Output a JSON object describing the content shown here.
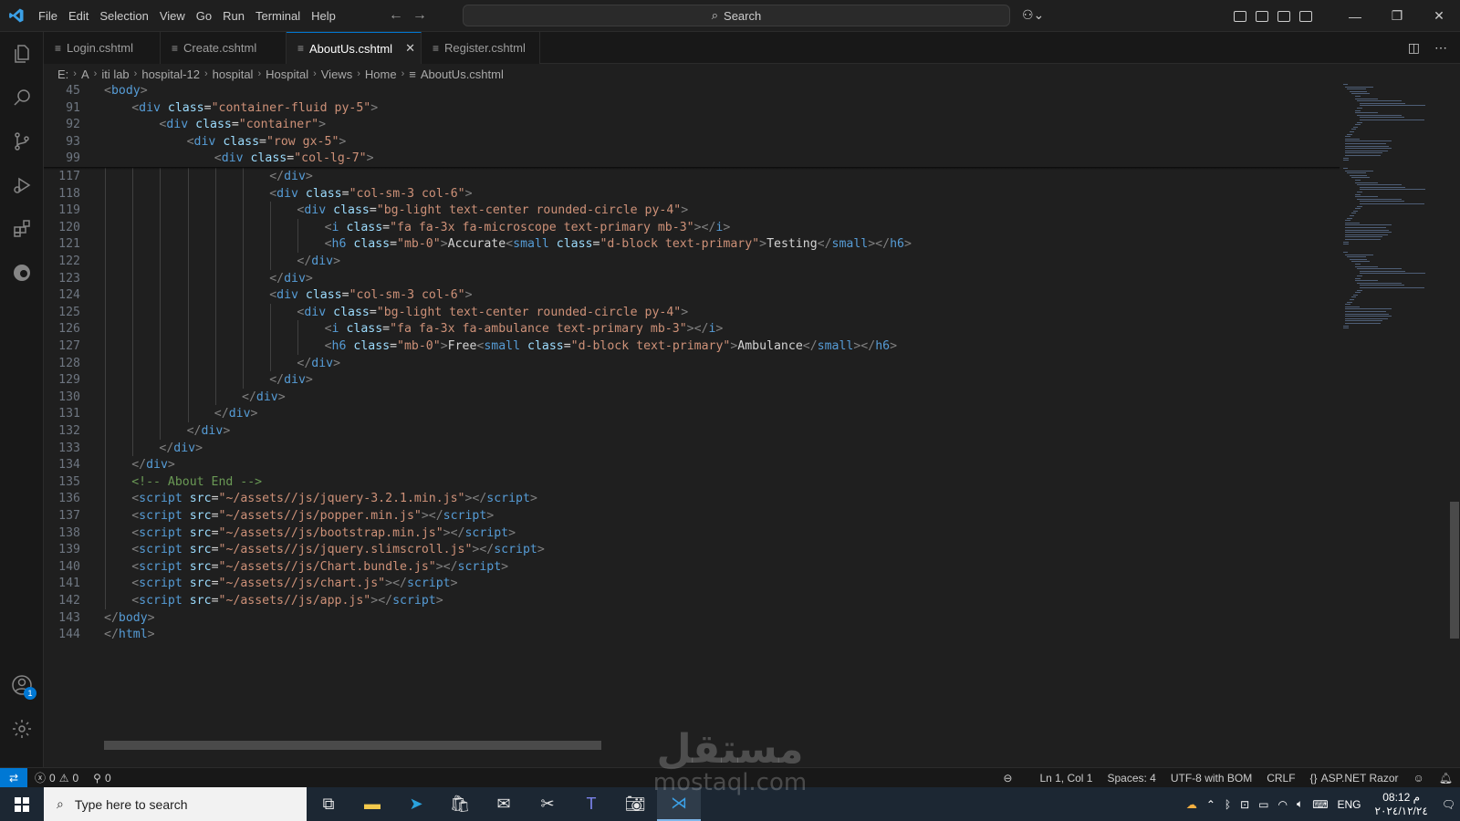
{
  "menu": [
    "File",
    "Edit",
    "Selection",
    "View",
    "Go",
    "Run",
    "Terminal",
    "Help"
  ],
  "search_label": "Search",
  "tabs": [
    {
      "label": "Login.cshtml",
      "active": false
    },
    {
      "label": "Create.cshtml",
      "active": false
    },
    {
      "label": "AboutUs.cshtml",
      "active": true
    },
    {
      "label": "Register.cshtml",
      "active": false
    }
  ],
  "breadcrumb": [
    "E:",
    "A",
    "iti lab",
    "hospital-12",
    "hospital",
    "Hospital",
    "Views",
    "Home",
    "AboutUs.cshtml"
  ],
  "sticky_lines": [
    {
      "num": "45",
      "indent": 0,
      "segs": [
        [
          "br",
          "<"
        ],
        [
          "t",
          "body"
        ],
        [
          "br",
          ">"
        ]
      ]
    },
    {
      "num": "91",
      "indent": 1,
      "segs": [
        [
          "br",
          "<"
        ],
        [
          "t",
          "div"
        ],
        [
          "tx",
          " "
        ],
        [
          "a",
          "class"
        ],
        [
          "tx",
          "="
        ],
        [
          "s",
          "\"container-fluid py-5\""
        ],
        [
          "br",
          ">"
        ]
      ]
    },
    {
      "num": "92",
      "indent": 2,
      "segs": [
        [
          "br",
          "<"
        ],
        [
          "t",
          "div"
        ],
        [
          "tx",
          " "
        ],
        [
          "a",
          "class"
        ],
        [
          "tx",
          "="
        ],
        [
          "s",
          "\"container\""
        ],
        [
          "br",
          ">"
        ]
      ]
    },
    {
      "num": "93",
      "indent": 3,
      "segs": [
        [
          "br",
          "<"
        ],
        [
          "t",
          "div"
        ],
        [
          "tx",
          " "
        ],
        [
          "a",
          "class"
        ],
        [
          "tx",
          "="
        ],
        [
          "s",
          "\"row gx-5\""
        ],
        [
          "br",
          ">"
        ]
      ]
    },
    {
      "num": "99",
      "indent": 4,
      "segs": [
        [
          "br",
          "<"
        ],
        [
          "t",
          "div"
        ],
        [
          "tx",
          " "
        ],
        [
          "a",
          "class"
        ],
        [
          "tx",
          "="
        ],
        [
          "s",
          "\"col-lg-7\""
        ],
        [
          "br",
          ">"
        ]
      ]
    }
  ],
  "lines": [
    {
      "num": "117",
      "indent": 6,
      "segs": [
        [
          "br",
          "</"
        ],
        [
          "t",
          "div"
        ],
        [
          "br",
          ">"
        ]
      ]
    },
    {
      "num": "118",
      "indent": 6,
      "segs": [
        [
          "br",
          "<"
        ],
        [
          "t",
          "div"
        ],
        [
          "tx",
          " "
        ],
        [
          "a",
          "class"
        ],
        [
          "tx",
          "="
        ],
        [
          "s",
          "\"col-sm-3 col-6\""
        ],
        [
          "br",
          ">"
        ]
      ]
    },
    {
      "num": "119",
      "indent": 7,
      "segs": [
        [
          "br",
          "<"
        ],
        [
          "t",
          "div"
        ],
        [
          "tx",
          " "
        ],
        [
          "a",
          "class"
        ],
        [
          "tx",
          "="
        ],
        [
          "s",
          "\"bg-light text-center rounded-circle py-4\""
        ],
        [
          "br",
          ">"
        ]
      ]
    },
    {
      "num": "120",
      "indent": 8,
      "segs": [
        [
          "br",
          "<"
        ],
        [
          "t",
          "i"
        ],
        [
          "tx",
          " "
        ],
        [
          "a",
          "class"
        ],
        [
          "tx",
          "="
        ],
        [
          "s",
          "\"fa fa-3x fa-microscope text-primary mb-3\""
        ],
        [
          "br",
          "></"
        ],
        [
          "t",
          "i"
        ],
        [
          "br",
          ">"
        ]
      ]
    },
    {
      "num": "121",
      "indent": 8,
      "segs": [
        [
          "br",
          "<"
        ],
        [
          "t",
          "h6"
        ],
        [
          "tx",
          " "
        ],
        [
          "a",
          "class"
        ],
        [
          "tx",
          "="
        ],
        [
          "s",
          "\"mb-0\""
        ],
        [
          "br",
          ">"
        ],
        [
          "tx",
          "Accurate"
        ],
        [
          "br",
          "<"
        ],
        [
          "t",
          "small"
        ],
        [
          "tx",
          " "
        ],
        [
          "a",
          "class"
        ],
        [
          "tx",
          "="
        ],
        [
          "s",
          "\"d-block text-primary\""
        ],
        [
          "br",
          ">"
        ],
        [
          "tx",
          "Testing"
        ],
        [
          "br",
          "</"
        ],
        [
          "t",
          "small"
        ],
        [
          "br",
          "></"
        ],
        [
          "t",
          "h6"
        ],
        [
          "br",
          ">"
        ]
      ]
    },
    {
      "num": "122",
      "indent": 7,
      "segs": [
        [
          "br",
          "</"
        ],
        [
          "t",
          "div"
        ],
        [
          "br",
          ">"
        ]
      ]
    },
    {
      "num": "123",
      "indent": 6,
      "segs": [
        [
          "br",
          "</"
        ],
        [
          "t",
          "div"
        ],
        [
          "br",
          ">"
        ]
      ]
    },
    {
      "num": "124",
      "indent": 6,
      "segs": [
        [
          "br",
          "<"
        ],
        [
          "t",
          "div"
        ],
        [
          "tx",
          " "
        ],
        [
          "a",
          "class"
        ],
        [
          "tx",
          "="
        ],
        [
          "s",
          "\"col-sm-3 col-6\""
        ],
        [
          "br",
          ">"
        ]
      ]
    },
    {
      "num": "125",
      "indent": 7,
      "segs": [
        [
          "br",
          "<"
        ],
        [
          "t",
          "div"
        ],
        [
          "tx",
          " "
        ],
        [
          "a",
          "class"
        ],
        [
          "tx",
          "="
        ],
        [
          "s",
          "\"bg-light text-center rounded-circle py-4\""
        ],
        [
          "br",
          ">"
        ]
      ]
    },
    {
      "num": "126",
      "indent": 8,
      "segs": [
        [
          "br",
          "<"
        ],
        [
          "t",
          "i"
        ],
        [
          "tx",
          " "
        ],
        [
          "a",
          "class"
        ],
        [
          "tx",
          "="
        ],
        [
          "s",
          "\"fa fa-3x fa-ambulance text-primary mb-3\""
        ],
        [
          "br",
          "></"
        ],
        [
          "t",
          "i"
        ],
        [
          "br",
          ">"
        ]
      ]
    },
    {
      "num": "127",
      "indent": 8,
      "segs": [
        [
          "br",
          "<"
        ],
        [
          "t",
          "h6"
        ],
        [
          "tx",
          " "
        ],
        [
          "a",
          "class"
        ],
        [
          "tx",
          "="
        ],
        [
          "s",
          "\"mb-0\""
        ],
        [
          "br",
          ">"
        ],
        [
          "tx",
          "Free"
        ],
        [
          "br",
          "<"
        ],
        [
          "t",
          "small"
        ],
        [
          "tx",
          " "
        ],
        [
          "a",
          "class"
        ],
        [
          "tx",
          "="
        ],
        [
          "s",
          "\"d-block text-primary\""
        ],
        [
          "br",
          ">"
        ],
        [
          "tx",
          "Ambulance"
        ],
        [
          "br",
          "</"
        ],
        [
          "t",
          "small"
        ],
        [
          "br",
          "></"
        ],
        [
          "t",
          "h6"
        ],
        [
          "br",
          ">"
        ]
      ]
    },
    {
      "num": "128",
      "indent": 7,
      "segs": [
        [
          "br",
          "</"
        ],
        [
          "t",
          "div"
        ],
        [
          "br",
          ">"
        ]
      ]
    },
    {
      "num": "129",
      "indent": 6,
      "segs": [
        [
          "br",
          "</"
        ],
        [
          "t",
          "div"
        ],
        [
          "br",
          ">"
        ]
      ]
    },
    {
      "num": "130",
      "indent": 5,
      "segs": [
        [
          "br",
          "</"
        ],
        [
          "t",
          "div"
        ],
        [
          "br",
          ">"
        ]
      ]
    },
    {
      "num": "131",
      "indent": 4,
      "segs": [
        [
          "br",
          "</"
        ],
        [
          "t",
          "div"
        ],
        [
          "br",
          ">"
        ]
      ]
    },
    {
      "num": "132",
      "indent": 3,
      "segs": [
        [
          "br",
          "</"
        ],
        [
          "t",
          "div"
        ],
        [
          "br",
          ">"
        ]
      ]
    },
    {
      "num": "133",
      "indent": 2,
      "segs": [
        [
          "br",
          "</"
        ],
        [
          "t",
          "div"
        ],
        [
          "br",
          ">"
        ]
      ]
    },
    {
      "num": "134",
      "indent": 1,
      "segs": [
        [
          "br",
          "</"
        ],
        [
          "t",
          "div"
        ],
        [
          "br",
          ">"
        ]
      ]
    },
    {
      "num": "135",
      "indent": 1,
      "segs": [
        [
          "c",
          "<!-- About End -->"
        ]
      ]
    },
    {
      "num": "136",
      "indent": 1,
      "segs": [
        [
          "br",
          "<"
        ],
        [
          "t",
          "script"
        ],
        [
          "tx",
          " "
        ],
        [
          "a",
          "src"
        ],
        [
          "tx",
          "="
        ],
        [
          "s",
          "\"~/assets//js/jquery-3.2.1.min.js\""
        ],
        [
          "br",
          "></"
        ],
        [
          "t",
          "script"
        ],
        [
          "br",
          ">"
        ]
      ]
    },
    {
      "num": "137",
      "indent": 1,
      "segs": [
        [
          "br",
          "<"
        ],
        [
          "t",
          "script"
        ],
        [
          "tx",
          " "
        ],
        [
          "a",
          "src"
        ],
        [
          "tx",
          "="
        ],
        [
          "s",
          "\"~/assets//js/popper.min.js\""
        ],
        [
          "br",
          "></"
        ],
        [
          "t",
          "script"
        ],
        [
          "br",
          ">"
        ]
      ]
    },
    {
      "num": "138",
      "indent": 1,
      "segs": [
        [
          "br",
          "<"
        ],
        [
          "t",
          "script"
        ],
        [
          "tx",
          " "
        ],
        [
          "a",
          "src"
        ],
        [
          "tx",
          "="
        ],
        [
          "s",
          "\"~/assets//js/bootstrap.min.js\""
        ],
        [
          "br",
          "></"
        ],
        [
          "t",
          "script"
        ],
        [
          "br",
          ">"
        ]
      ]
    },
    {
      "num": "139",
      "indent": 1,
      "segs": [
        [
          "br",
          "<"
        ],
        [
          "t",
          "script"
        ],
        [
          "tx",
          " "
        ],
        [
          "a",
          "src"
        ],
        [
          "tx",
          "="
        ],
        [
          "s",
          "\"~/assets//js/jquery.slimscroll.js\""
        ],
        [
          "br",
          "></"
        ],
        [
          "t",
          "script"
        ],
        [
          "br",
          ">"
        ]
      ]
    },
    {
      "num": "140",
      "indent": 1,
      "segs": [
        [
          "br",
          "<"
        ],
        [
          "t",
          "script"
        ],
        [
          "tx",
          " "
        ],
        [
          "a",
          "src"
        ],
        [
          "tx",
          "="
        ],
        [
          "s",
          "\"~/assets//js/Chart.bundle.js\""
        ],
        [
          "br",
          "></"
        ],
        [
          "t",
          "script"
        ],
        [
          "br",
          ">"
        ]
      ]
    },
    {
      "num": "141",
      "indent": 1,
      "segs": [
        [
          "br",
          "<"
        ],
        [
          "t",
          "script"
        ],
        [
          "tx",
          " "
        ],
        [
          "a",
          "src"
        ],
        [
          "tx",
          "="
        ],
        [
          "s",
          "\"~/assets//js/chart.js\""
        ],
        [
          "br",
          "></"
        ],
        [
          "t",
          "script"
        ],
        [
          "br",
          ">"
        ]
      ]
    },
    {
      "num": "142",
      "indent": 1,
      "segs": [
        [
          "br",
          "<"
        ],
        [
          "t",
          "script"
        ],
        [
          "tx",
          " "
        ],
        [
          "a",
          "src"
        ],
        [
          "tx",
          "="
        ],
        [
          "s",
          "\"~/assets//js/app.js\""
        ],
        [
          "br",
          "></"
        ],
        [
          "t",
          "script"
        ],
        [
          "br",
          ">"
        ]
      ]
    },
    {
      "num": "143",
      "indent": 0,
      "segs": [
        [
          "br",
          "</"
        ],
        [
          "t",
          "body"
        ],
        [
          "br",
          ">"
        ]
      ]
    },
    {
      "num": "144",
      "indent": 0,
      "segs": [
        [
          "br",
          "</"
        ],
        [
          "t",
          "html"
        ],
        [
          "br",
          ">"
        ]
      ]
    }
  ],
  "status": {
    "errors": "0",
    "warnings": "0",
    "ports": "0",
    "position": "Ln 1, Col 1",
    "spaces": "Spaces: 4",
    "encoding": "UTF-8 with BOM",
    "eol": "CRLF",
    "language": "ASP.NET Razor",
    "account_badge": "1"
  },
  "taskbar": {
    "search_placeholder": "Type here to search",
    "lang": "ENG",
    "time": "08:12 م",
    "date": "٢٠٢٤/١٢/٢٤"
  },
  "watermark": {
    "arabic": "مستقل",
    "latin": "mostaql.com"
  },
  "colors": {
    "accent": "#0078d4",
    "tag": "#569cd6",
    "attr": "#9cdcfe",
    "string": "#ce9178",
    "comment": "#6a9955"
  }
}
